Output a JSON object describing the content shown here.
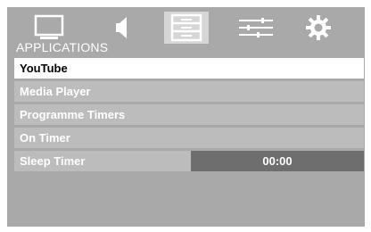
{
  "section_title": "APPLICATIONS",
  "tabs": [
    {
      "icon": "picture-icon",
      "active": false
    },
    {
      "icon": "sound-icon",
      "active": false
    },
    {
      "icon": "applications-icon",
      "active": true
    },
    {
      "icon": "settings-sliders-icon",
      "active": false
    },
    {
      "icon": "gear-icon",
      "active": false
    }
  ],
  "menu": {
    "items": [
      {
        "label": "YouTube",
        "selected": true
      },
      {
        "label": "Media Player"
      },
      {
        "label": "Programme Timers"
      },
      {
        "label": "On Timer"
      },
      {
        "label": "Sleep Timer",
        "value": "00:00"
      }
    ]
  },
  "colors": {
    "panel": "#a9a9a9",
    "row": "#bcbcbc",
    "selected_row": "#ffffff",
    "value_box": "#6e6e6e",
    "active_tab": "#d6d6d6"
  }
}
